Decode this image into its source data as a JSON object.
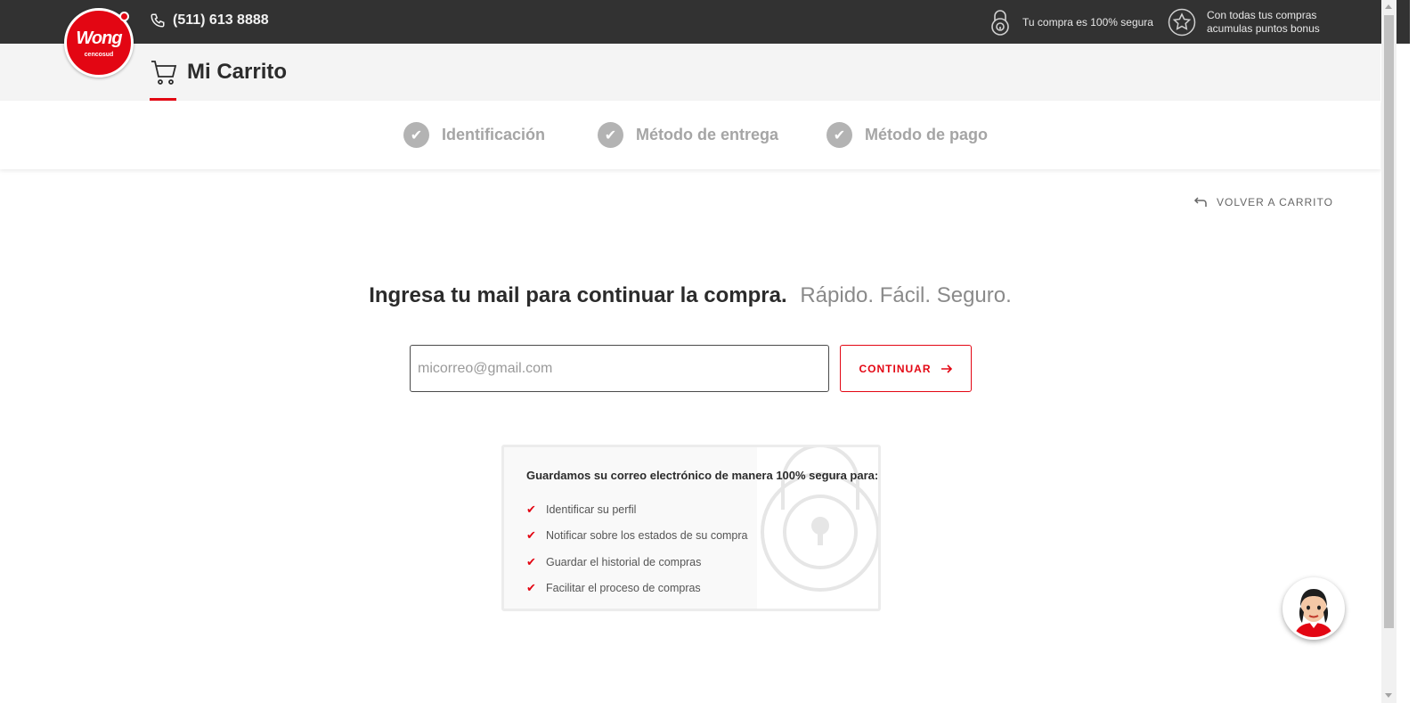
{
  "header": {
    "logo_text": "Wong",
    "logo_subtext": "cencosud",
    "phone": "(511) 613 8888",
    "secure_text": "Tu compra es 100% segura",
    "bonus_line1": "Con todas tus compras",
    "bonus_line2": "acumulas puntos bonus"
  },
  "cart": {
    "title": "Mi Carrito"
  },
  "steps": [
    {
      "label": "Identificación"
    },
    {
      "label": "Método de entrega"
    },
    {
      "label": "Método de pago"
    }
  ],
  "back_link": "VOLVER A CARRITO",
  "main": {
    "heading_strong": "Ingresa tu mail para continuar la compra.",
    "heading_light": "Rápido. Fácil. Seguro.",
    "email_placeholder": "micorreo@gmail.com",
    "email_value": "",
    "continue_label": "CONTINUAR"
  },
  "info": {
    "title": "Guardamos su correo electrónico de manera 100% segura para:",
    "items": [
      "Identificar su perfil",
      "Notificar sobre los estados de su compra",
      "Guardar el historial de compras",
      "Facilitar el proceso de compras"
    ]
  },
  "colors": {
    "brand_red": "#e30613",
    "topbar": "#323232",
    "step_gray": "#b3b3b3"
  },
  "icons": {
    "phone": "phone-icon",
    "secure": "padlock-icon",
    "bonus": "star-icon",
    "cart": "cart-icon",
    "step": "check-circle-icon",
    "back": "return-arrow-icon",
    "continue": "arrow-right-icon",
    "list_tick": "checkmark-icon",
    "chat": "chat-avatar"
  }
}
